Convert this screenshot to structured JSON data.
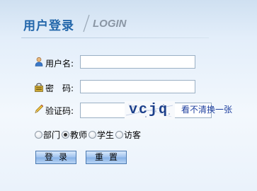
{
  "header": {
    "title_cn": "用户登录",
    "title_en": "LOGIN"
  },
  "form": {
    "username_label": "用户名:",
    "username_value": "",
    "password_label": "密　码:",
    "password_value": "",
    "captcha_label": "验证码:",
    "captcha_value": "",
    "captcha_image_text": "vcjq",
    "captcha_refresh_link": "看不清换一张"
  },
  "roles": {
    "options": [
      {
        "label": "部门",
        "checked": false
      },
      {
        "label": "教师",
        "checked": true
      },
      {
        "label": "学生",
        "checked": false
      },
      {
        "label": "访客",
        "checked": false
      }
    ]
  },
  "buttons": {
    "login_label": "登录",
    "reset_label": "重置"
  },
  "colors": {
    "title": "#2266aa",
    "title_en": "#8a96a4",
    "link": "#1e3f9f",
    "button_border": "#4a79b1"
  },
  "icons": {
    "username": "user-icon",
    "password": "lock-icon",
    "captcha": "pencil-icon"
  }
}
